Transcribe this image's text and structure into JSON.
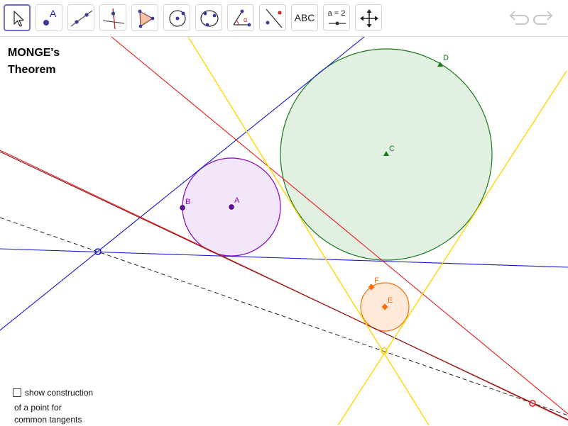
{
  "toolbar": {
    "tools": [
      {
        "name": "move-tool",
        "icon": "arrow-cursor-icon",
        "active": true
      },
      {
        "name": "point-tool",
        "icon": "point-A-icon"
      },
      {
        "name": "line-tool",
        "icon": "line-through-two-points-icon"
      },
      {
        "name": "perpendicular-line-tool",
        "icon": "perpendicular-line-icon"
      },
      {
        "name": "polygon-tool",
        "icon": "polygon-icon"
      },
      {
        "name": "circle-center-point-tool",
        "icon": "circle-center-point-icon"
      },
      {
        "name": "circle-three-points-tool",
        "icon": "circle-three-points-icon"
      },
      {
        "name": "angle-tool",
        "icon": "angle-icon"
      },
      {
        "name": "reflect-tool",
        "icon": "reflect-about-line-icon"
      },
      {
        "name": "text-tool",
        "icon": "text-abc-icon",
        "label": "ABC"
      },
      {
        "name": "slider-tool",
        "icon": "slider-icon",
        "label": "a = 2"
      },
      {
        "name": "move-graphics-view-tool",
        "icon": "four-way-arrow-icon"
      }
    ],
    "undo_icon": "undo-icon",
    "redo_icon": "redo-icon"
  },
  "title": {
    "line1": "MONGE's",
    "line2": "Theorem"
  },
  "construction": {
    "checkbox_checked": false,
    "label": "show construction",
    "line2": "of a point for",
    "line3": "common tangents"
  },
  "points": {
    "A": "A",
    "B": "B",
    "C": "C",
    "D": "D",
    "E": "E",
    "F": "F"
  },
  "colors": {
    "circle_a": "#8b00c9",
    "circle_a_fill": "#f2e6fb",
    "circle_c": "#1a7a1a",
    "circle_c_fill": "#e2f0e2",
    "circle_e": "#ff6a00",
    "circle_e_fill": "#ffeada",
    "tangent_blue": "#1515d0",
    "tangent_red": "#e81a1a",
    "tangent_yellow": "#ffd600",
    "monge_line": "#8b1a1a",
    "construction_line": "#222222",
    "accent": "#6b6fc9"
  }
}
